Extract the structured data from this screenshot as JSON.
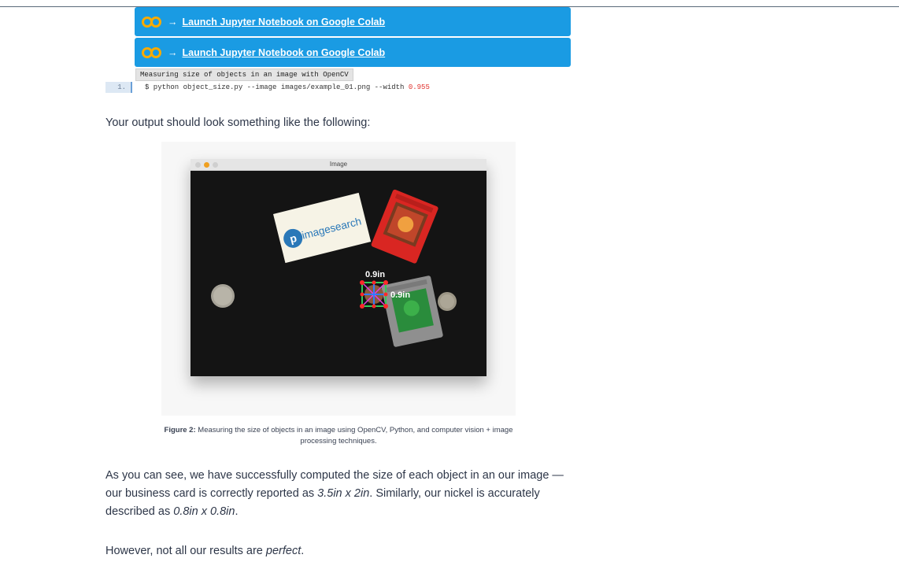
{
  "colab_buttons": [
    {
      "arrow": "→",
      "label": "Launch Jupyter Notebook on Google Colab"
    },
    {
      "arrow": "→",
      "label": "Launch Jupyter Notebook on Google Colab"
    }
  ],
  "code_block": {
    "title": "Measuring size of objects in an image with OpenCV",
    "line_number": "1.",
    "command": "$ python object_size.py --image images/example_01.png --width ",
    "width_value": "0.955"
  },
  "intro_text": "Your output should look something like the following:",
  "figure": {
    "window_title": "Image",
    "card_text": "imagesearch",
    "card_logo_letter": "p",
    "measure_width": "0.9in",
    "measure_height": "0.9in",
    "caption_label": "Figure 2:",
    "caption_text": " Measuring the size of objects in an image using OpenCV, Python, and computer vision + image processing techniques."
  },
  "result_paragraph": {
    "part1": "As you can see, we have successfully computed the size of each object in an our image — our business card is correctly reported as ",
    "card_size": "3.5in x 2in",
    "part2": ". Similarly, our nickel is accurately described as ",
    "nickel_size": "0.8in x 0.8in",
    "part3": "."
  },
  "final_paragraph": {
    "part1": "However, not all our results are ",
    "emphasis": "perfect",
    "part2": "."
  },
  "colors": {
    "colab_blue": "#1a9be3",
    "text": "#2d3648",
    "code_number_red": "#e0302c"
  }
}
